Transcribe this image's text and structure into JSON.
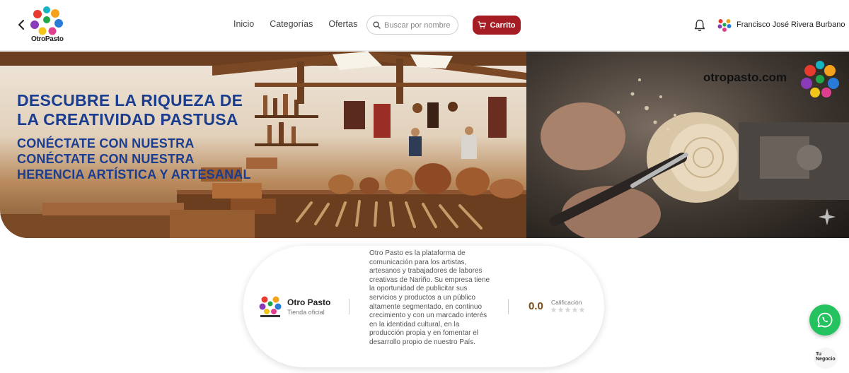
{
  "header": {
    "logo_text": "OtroPasto",
    "nav": [
      "Inicio",
      "Categorías",
      "Ofertas"
    ],
    "search_placeholder": "Buscar por nombre",
    "cart_label": "Carrito",
    "user_name": "Francisco José Rivera Burbano"
  },
  "banner": {
    "headline_line1": "DESCUBRE LA RIQUEZA DE",
    "headline_line2": "LA CREATIVIDAD PASTUSA",
    "sub_line1": "CONÉCTATE CON NUESTRA",
    "sub_line2": "CONÉCTATE CON NUESTRA",
    "sub_line3": "HERENCIA ARTÍSTICA Y ARTESANAL",
    "site_url": "otropasto.com"
  },
  "store": {
    "name": "Otro Pasto",
    "tag": "Tienda oficial",
    "description": "Otro Pasto es la plataforma de comunicación para los artistas, artesanos y trabajadores de labores creativas de Nariño. Su empresa tiene la oportunidad de publicitar sus servicios y productos a un público altamente segmentado, en continuo crecimiento y con un marcado interés en la identidad cultural, en la producción propia y en fomentar el desarrollo propio de nuestro País.",
    "rating": "0.0",
    "rating_label": "Calificación",
    "stars_filled": 0,
    "stars_total": 5
  },
  "floating": {
    "tunegocio_line1": "Tu",
    "tunegocio_line2": "Negocio"
  },
  "colors": {
    "brand_red": "#a51c24",
    "headline_blue": "#1b3d8f",
    "whatsapp_green": "#25c260"
  },
  "icons": [
    "back-chevron-icon",
    "search-icon",
    "cart-icon",
    "bell-icon",
    "whatsapp-icon",
    "sparkle-icon"
  ]
}
